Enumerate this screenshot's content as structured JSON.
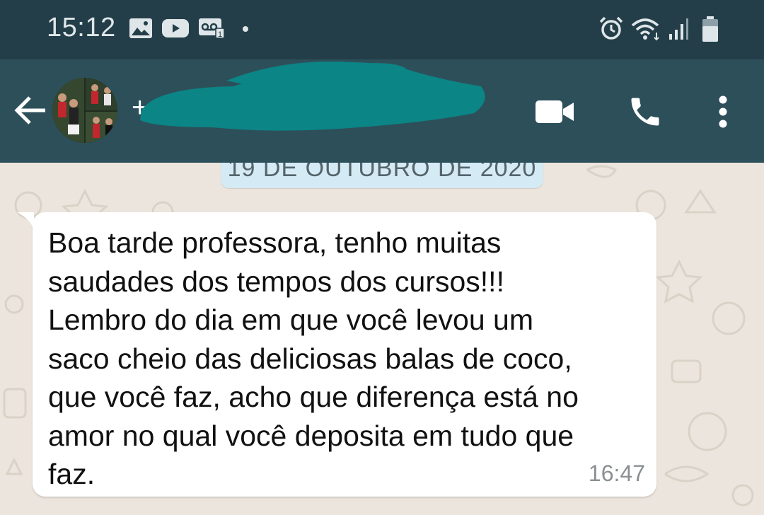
{
  "status_bar": {
    "time": "15:12",
    "icons": [
      "image-icon",
      "youtube-icon",
      "voicemail-icon",
      "dot-icon",
      "alarm-icon",
      "wifi-icon",
      "signal-icon",
      "battery-icon"
    ]
  },
  "app_bar": {
    "contact_name": "+",
    "icons": [
      "back-arrow-icon",
      "video-call-icon",
      "phone-icon",
      "more-vertical-icon"
    ]
  },
  "chat": {
    "date_chip": "19 DE OUTUBRO DE 2020",
    "messages": [
      {
        "text": "Boa tarde professora, tenho muitas\nsaudades dos tempos dos cursos!!!\nLembro do dia em que você levou um\nsaco cheio das deliciosas balas de coco,\nque você faz, acho que  diferença está no\namor no qual você deposita em tudo que\nfaz.",
        "time": "16:47"
      }
    ]
  },
  "colors": {
    "status_bar": "#233e48",
    "app_bar": "#2d4f5a",
    "chat_background": "#ece5dd",
    "date_chip": "#d4eaf4",
    "redaction": "#0b8585"
  }
}
